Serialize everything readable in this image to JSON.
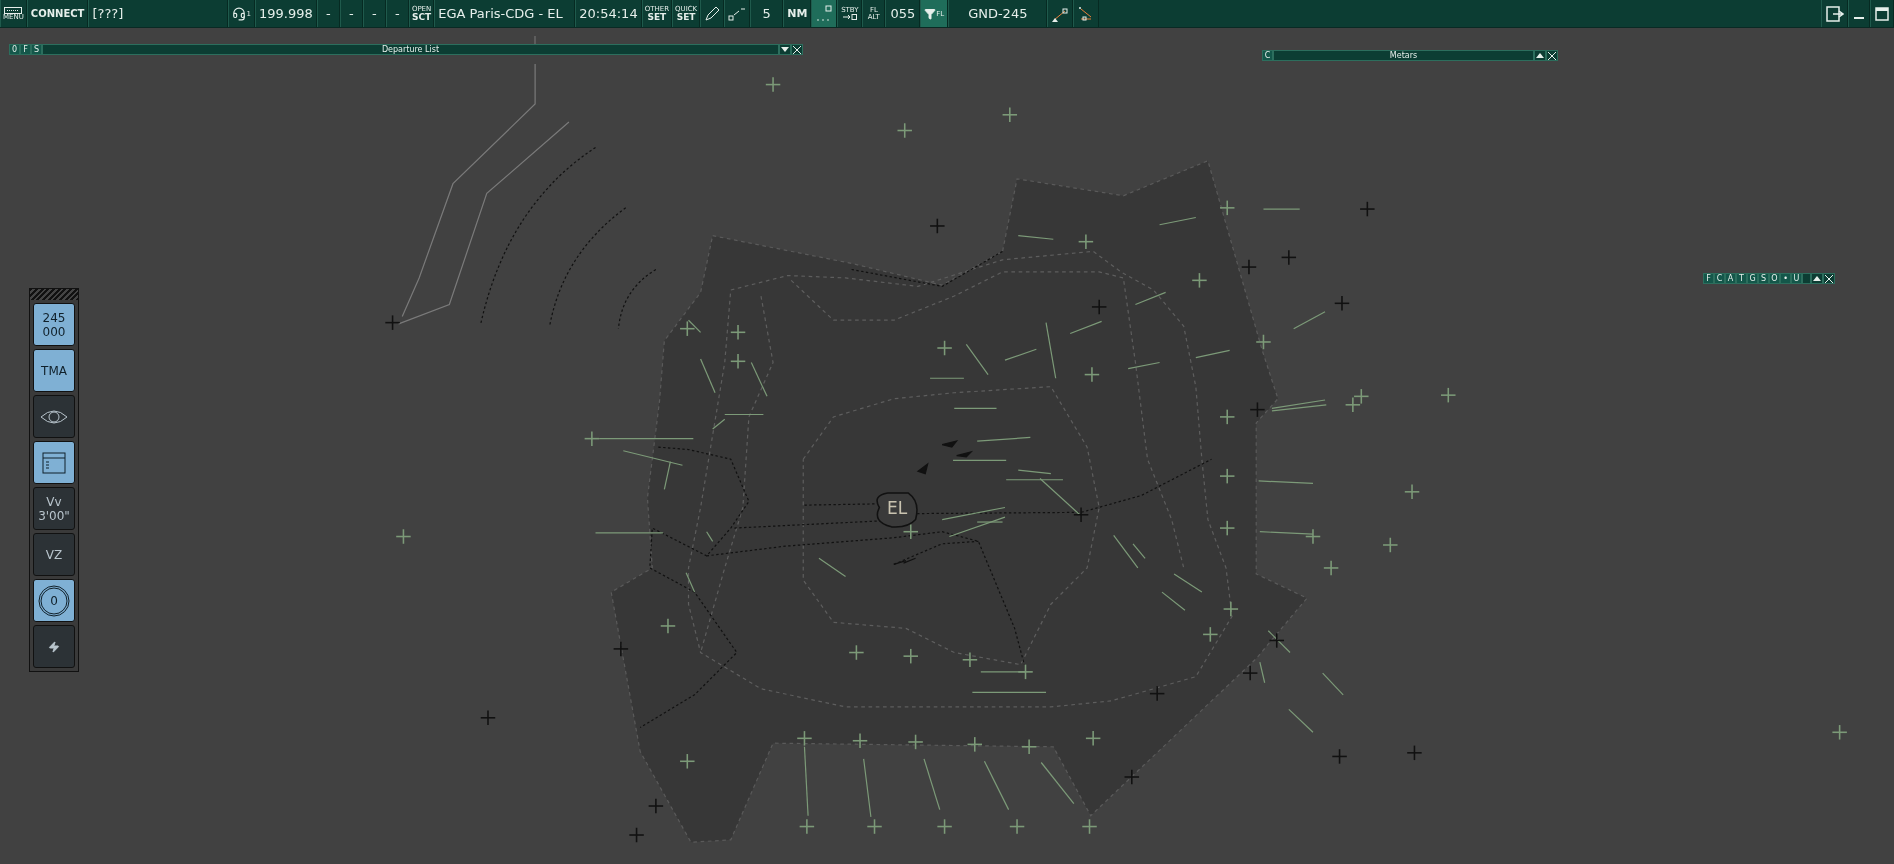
{
  "top_bar": {
    "menu_label": "MENU",
    "connect": "CONNECT",
    "callsign": "[???]",
    "headset_index": "1",
    "frequency": "199.998",
    "dashes": [
      "-",
      "-",
      "-",
      "-"
    ],
    "open_sct": [
      "OPEN",
      "SCT"
    ],
    "sector": "EGA Paris-CDG - EL",
    "time": "20:54:14",
    "other_set": [
      "OTHER",
      "SET"
    ],
    "quick_set": [
      "QUICK",
      "SET"
    ],
    "range": "5",
    "unit": "NM",
    "stby": "STBY",
    "fl_alt": [
      "FL",
      "ALT"
    ],
    "level": "055",
    "filter_label": "FL",
    "position": "GND-245"
  },
  "windows": {
    "departure_list": {
      "buttons": [
        "0",
        "F",
        "S"
      ],
      "title": "Departure List"
    },
    "metars": {
      "buttons": [
        "C"
      ],
      "title": "Metars"
    },
    "filter_toolbar": {
      "buttons": [
        "F",
        "C",
        "A",
        "T",
        "G",
        "S",
        "O",
        "•",
        "U"
      ]
    }
  },
  "left_panel": {
    "items": [
      {
        "kind": "text",
        "lines": [
          "245",
          "000"
        ],
        "on": true
      },
      {
        "kind": "text",
        "lines": [
          "TMA"
        ],
        "on": true
      },
      {
        "kind": "eye",
        "on": false
      },
      {
        "kind": "list",
        "on": true
      },
      {
        "kind": "text",
        "lines": [
          "Vv",
          "3'00\""
        ],
        "on": false
      },
      {
        "kind": "text",
        "lines": [
          "VZ"
        ],
        "on": false
      },
      {
        "kind": "circle",
        "label": "0",
        "on": true
      },
      {
        "kind": "bolt",
        "on": false
      }
    ]
  },
  "map": {
    "airport_label": "EL"
  }
}
